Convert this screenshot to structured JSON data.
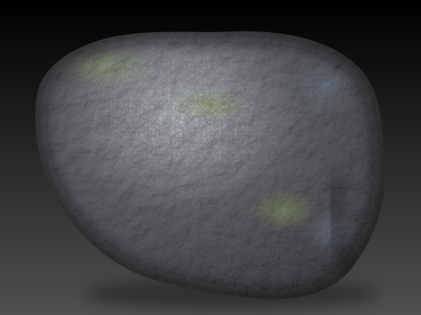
{
  "scene": {
    "background_top": "#000000",
    "background_bottom": "#505050",
    "rock_dark": "#1f1f21",
    "rock_mid": "#3a3b3e",
    "rock_light": "#77797d",
    "moss": "#5e6a3c",
    "blue_tint": "#4a5566",
    "highlight": "#a9abae"
  }
}
